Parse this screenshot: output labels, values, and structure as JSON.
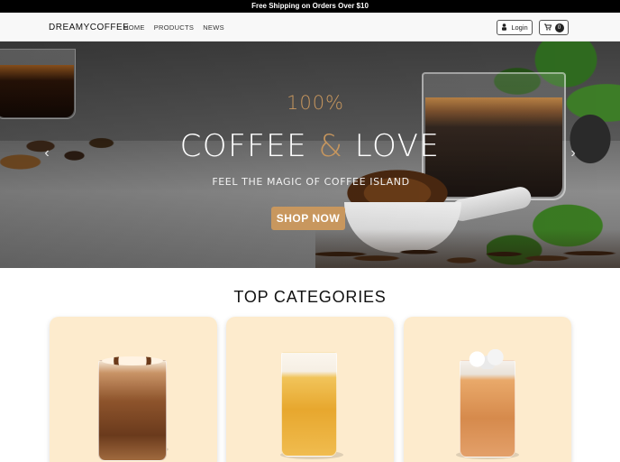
{
  "topbar": {
    "text": "Free Shipping on Orders Over $10"
  },
  "navbar": {
    "brand": "DREAMYCOFFEE",
    "links": [
      "HOME",
      "PRODUCTS",
      "NEWS"
    ],
    "login_label": "Login",
    "cart_count": "0"
  },
  "hero": {
    "eyebrow": "100%",
    "title_part1": "COFFEE ",
    "title_amp": "&",
    "title_part2": " LOVE",
    "tagline": "FEEL THE MAGIC OF COFFEE ISLAND",
    "cta_label": "SHOP NOW",
    "prev_glyph": "‹",
    "next_glyph": "›"
  },
  "categories": {
    "title": "TOP CATEGORIES"
  },
  "colors": {
    "accent": "#c8975e",
    "card_bg": "#fdebcd",
    "topbar_bg": "#000000"
  },
  "icons": {
    "login": "user-icon",
    "cart": "cart-icon"
  }
}
